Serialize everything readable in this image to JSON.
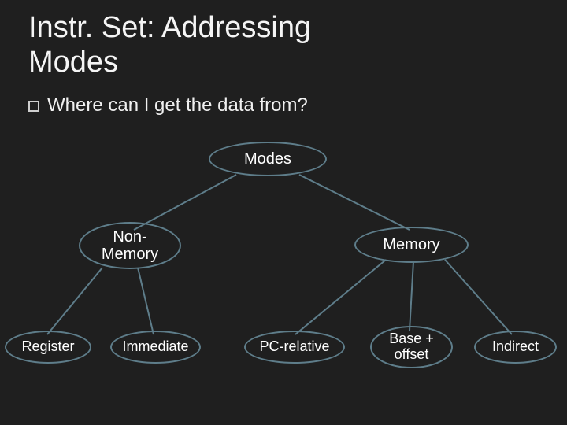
{
  "title_line1": "Instr. Set: Addressing",
  "title_line2": "Modes",
  "bullet_text": "Where can I get the data from?",
  "nodes": {
    "root": "Modes",
    "non_memory": "Non-\nMemory",
    "memory": "Memory",
    "register": "Register",
    "immediate": "Immediate",
    "pc_relative": "PC-relative",
    "base_offset": "Base +\noffset",
    "indirect": "Indirect"
  },
  "chart_data": {
    "type": "tree",
    "root": "Modes",
    "children": [
      {
        "label": "Non-Memory",
        "children": [
          {
            "label": "Register"
          },
          {
            "label": "Immediate"
          }
        ]
      },
      {
        "label": "Memory",
        "children": [
          {
            "label": "PC-relative"
          },
          {
            "label": "Base + offset"
          },
          {
            "label": "Indirect"
          }
        ]
      }
    ]
  }
}
